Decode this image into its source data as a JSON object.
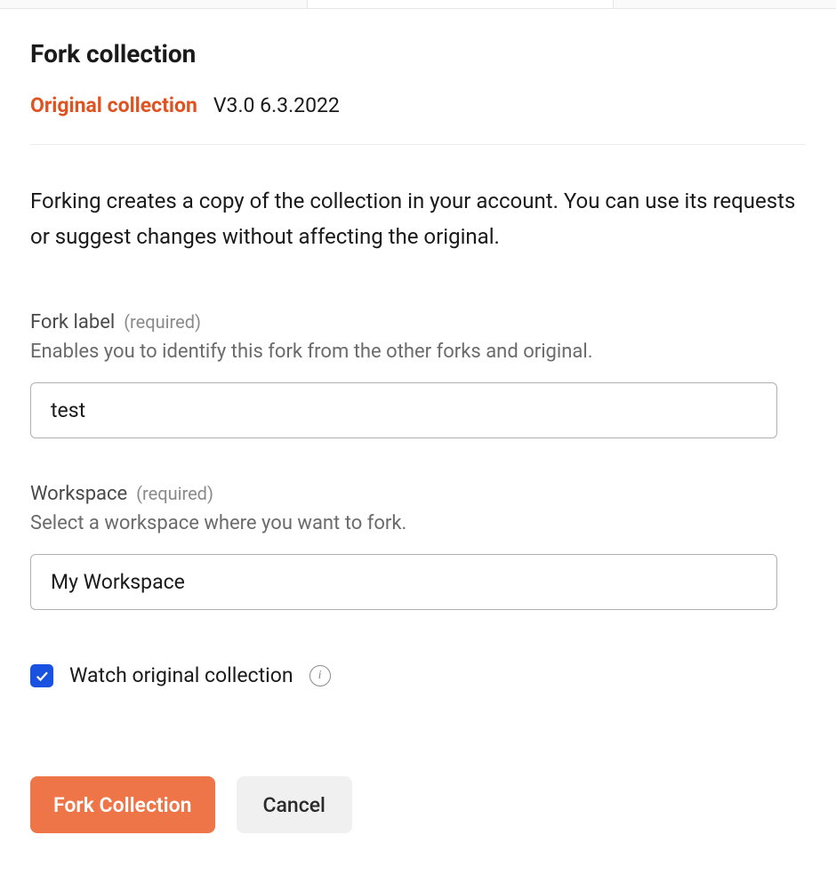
{
  "header": {
    "title": "Fork collection",
    "original_label": "Original collection",
    "original_version": "V3.0 6.3.2022"
  },
  "description": "Forking creates a copy of the collection in your account. You can use its requests or suggest changes without affecting the original.",
  "form": {
    "fork_label": {
      "label": "Fork label",
      "required_text": "(required)",
      "help": "Enables you to identify this fork from the other forks and original.",
      "value": "test"
    },
    "workspace": {
      "label": "Workspace",
      "required_text": "(required)",
      "help": "Select a workspace where you want to fork.",
      "value": "My Workspace"
    },
    "watch": {
      "label": "Watch original collection",
      "checked": true
    }
  },
  "buttons": {
    "primary": "Fork Collection",
    "secondary": "Cancel"
  }
}
